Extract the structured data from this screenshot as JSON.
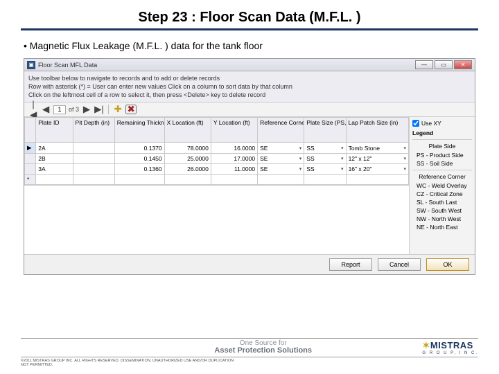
{
  "slide": {
    "title": "Step 23 : Floor Scan Data (M.F.L. )",
    "bullet": "Magnetic Flux Leakage (M.F.L. ) data for the tank floor"
  },
  "window": {
    "title": "Floor Scan MFL Data",
    "instructions": [
      "Use toolbar below to navigate to records and to add or delete records",
      "Row with asterisk (*) = User can enter new values     Click on a column to sort data by that column",
      "Click on the leftmost cell of a row to select it, then press <Delete> key to delete record"
    ],
    "nav": {
      "pos": "1",
      "of": "of 3"
    }
  },
  "columns": {
    "c0": "Plate ID",
    "c1": "Pit Depth (in)",
    "c2": "Remaining Thickness (in)",
    "c3": "X Location (ft)",
    "c4": "Y Location (ft)",
    "c5": "Reference Corner",
    "c6": "Plate Size (PS, SS)",
    "c7": "Lap Patch Size (in)"
  },
  "rows": [
    {
      "sel": "▶",
      "plate": "2A",
      "pit": "",
      "rem": "0.1370",
      "x": "78.0000",
      "y": "16.0000",
      "ref": "SE",
      "side": "SS",
      "patch": "Tomb Stone"
    },
    {
      "sel": "",
      "plate": "2B",
      "pit": "",
      "rem": "0.1450",
      "x": "25.0000",
      "y": "17.0000",
      "ref": "SE",
      "side": "SS",
      "patch": "12\" x 12\""
    },
    {
      "sel": "",
      "plate": "3A",
      "pit": "",
      "rem": "0.1360",
      "x": "26.0000",
      "y": "11.0000",
      "ref": "SE",
      "side": "SS",
      "patch": "16\" x 20\""
    },
    {
      "sel": "*",
      "plate": "",
      "pit": "",
      "rem": "",
      "x": "",
      "y": "",
      "ref": "",
      "side": "",
      "patch": ""
    }
  ],
  "sidebar": {
    "use_xy": "Use XY",
    "legend": "Legend",
    "plate_side_title": "Plate Side",
    "ps": "PS - Product Side",
    "ss": "SS - Soil Side",
    "ref_title": "Reference Corner",
    "wc": "WC - Weld Overlay",
    "cz": "CZ - Critical Zone",
    "sl": "SL - South Last",
    "sw": "SW - South West",
    "nw": "NW - North West",
    "ne": "NE - North East"
  },
  "buttons": {
    "report": "Report",
    "cancel": "Cancel",
    "ok": "OK"
  },
  "footer": {
    "tag1": "One Source for",
    "tag2": "Asset Protection Solutions",
    "brand": "MISTRAS",
    "brand2": "G R O U P,  I N C.",
    "copyright": "©2011 MISTRAS GROUP INC. ALL RIGHTS RESERVED. DISSEMINATION, UNAUTHORIZED USE AND/OR DUPLICATION NOT PERMITTED."
  }
}
